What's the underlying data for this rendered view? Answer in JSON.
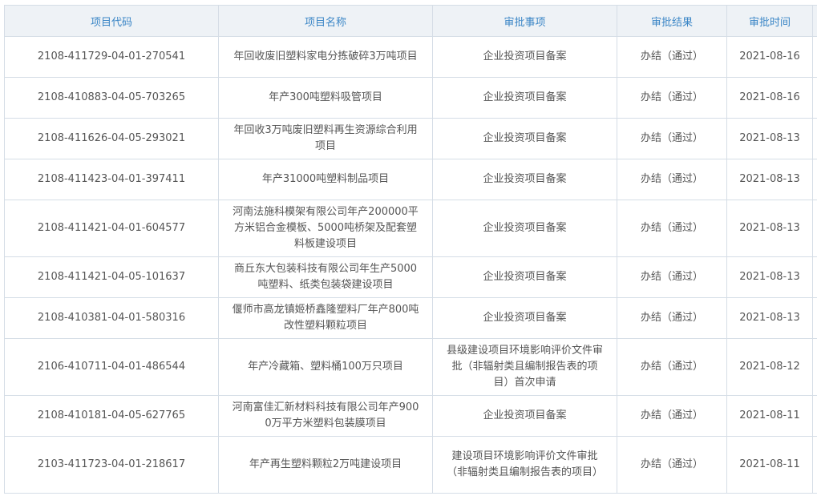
{
  "table": {
    "headers": [
      "项目代码",
      "项目名称",
      "审批事项",
      "审批结果",
      "审批时间"
    ],
    "rows": [
      {
        "code": "2108-411729-04-01-270541",
        "name": "年回收废旧塑料家电分拣破碎3万吨项目",
        "item": "企业投资项目备案",
        "result": "办结（通过）",
        "date": "2021-08-16"
      },
      {
        "code": "2108-410883-04-05-703265",
        "name": "年产300吨塑料吸管项目",
        "item": "企业投资项目备案",
        "result": "办结（通过）",
        "date": "2021-08-16"
      },
      {
        "code": "2108-411626-04-05-293021",
        "name": "年回收3万吨废旧塑料再生资源综合利用项目",
        "item": "企业投资项目备案",
        "result": "办结（通过）",
        "date": "2021-08-13"
      },
      {
        "code": "2108-411423-04-01-397411",
        "name": "年产31000吨塑料制品项目",
        "item": "企业投资项目备案",
        "result": "办结（通过）",
        "date": "2021-08-13"
      },
      {
        "code": "2108-411421-04-01-604577",
        "name": "河南法施科模架有限公司年产200000平方米铝合金模板、5000吨桥架及配套塑料板建设项目",
        "item": "企业投资项目备案",
        "result": "办结（通过）",
        "date": "2021-08-13"
      },
      {
        "code": "2108-411421-04-05-101637",
        "name": "商丘东大包装科技有限公司年生产5000吨塑料、纸类包装袋建设项目",
        "item": "企业投资项目备案",
        "result": "办结（通过）",
        "date": "2021-08-13"
      },
      {
        "code": "2108-410381-04-01-580316",
        "name": "偃师市高龙镇姬桥鑫隆塑料厂年产800吨改性塑料颗粒项目",
        "item": "企业投资项目备案",
        "result": "办结（通过）",
        "date": "2021-08-13"
      },
      {
        "code": "2106-410711-04-01-486544",
        "name": "年产冷藏箱、塑料桶100万只项目",
        "item": "县级建设项目环境影响评价文件审批（非辐射类且编制报告表的项目）首次申请",
        "result": "办结（通过）",
        "date": "2021-08-12"
      },
      {
        "code": "2108-410181-04-05-627765",
        "name": "河南富佳汇新材料科技有限公司年产9000万平方米塑料包装膜项目",
        "item": "企业投资项目备案",
        "result": "办结（通过）",
        "date": "2021-08-11"
      },
      {
        "code": "2103-411723-04-01-218617",
        "name": "年产再生塑料颗粒2万吨建设项目",
        "item": "建设项目环境影响评价文件审批（非辐射类且编制报告表的项目）",
        "result": "办结（通过）",
        "date": "2021-08-11"
      }
    ]
  },
  "colors": {
    "header_bg": "#eef2f6",
    "header_text": "#3b86c6",
    "border": "#d5dde6",
    "cell_text": "#555555"
  }
}
